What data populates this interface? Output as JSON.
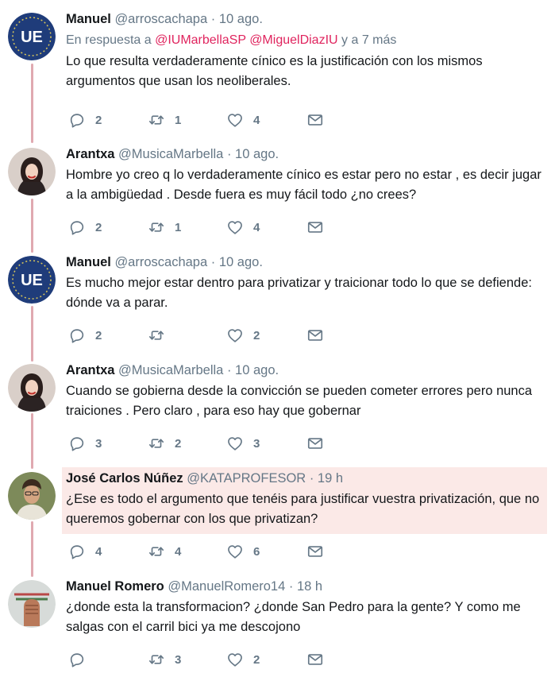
{
  "colors": {
    "thread_line": "#e0a9b0",
    "highlight_bg": "#fbe9e7",
    "mention": "#e0245e",
    "secondary_text": "#657786"
  },
  "tweets": [
    {
      "name": "Manuel",
      "handle": "@arroscachapa",
      "time": "10 ago.",
      "avatar_icon": "ue-logo-avatar",
      "avatar_text": "UE",
      "reply_to": {
        "prefix": "En respuesta a",
        "mentions": [
          "@IUMarbellaSP",
          "@MiguelDiazIU"
        ],
        "suffix": "y a 7 más"
      },
      "text": "Lo que resulta verdaderamente cínico es la justificación con los mismos argumentos que usan los neoliberales.",
      "replies": "2",
      "retweets": "1",
      "likes": "4"
    },
    {
      "name": "Arantxa",
      "handle": "@MusicaMarbella",
      "time": "10 ago.",
      "avatar_icon": "woman-portrait-avatar",
      "text": "Hombre yo creo q lo verdaderamente cínico es estar pero no estar , es decir jugar a la ambigüedad . Desde fuera es muy fácil todo ¿no crees?",
      "replies": "2",
      "retweets": "1",
      "likes": "4"
    },
    {
      "name": "Manuel",
      "handle": "@arroscachapa",
      "time": "10 ago.",
      "avatar_icon": "ue-logo-avatar",
      "avatar_text": "UE",
      "text": "Es mucho mejor estar dentro para privatizar y traicionar todo lo que se defiende: dónde va a parar.",
      "replies": "2",
      "retweets": "",
      "likes": "2"
    },
    {
      "name": "Arantxa",
      "handle": "@MusicaMarbella",
      "time": "10 ago.",
      "avatar_icon": "woman-portrait-avatar",
      "text": "Cuando se gobierna desde la convicción se pueden cometer  errores pero nunca traiciones . Pero claro , para eso hay que gobernar",
      "replies": "3",
      "retweets": "2",
      "likes": "3"
    },
    {
      "name": "José Carlos Núñez",
      "handle": "@KATAPROFESOR",
      "time": "19 h",
      "avatar_icon": "man-portrait-avatar",
      "text": "¿Ese es todo el argumento que tenéis para justificar vuestra privatización, que no queremos gobernar con los que privatizan?",
      "replies": "4",
      "retweets": "4",
      "likes": "6"
    },
    {
      "name": "Manuel Romero",
      "handle": "@ManuelRomero14",
      "time": "18 h",
      "avatar_icon": "raised-fist-avatar",
      "text": "¿donde esta la transformacion? ¿donde San Pedro para la gente? Y como me salgas con el carril bici ya me descojono",
      "replies": "",
      "retweets": "3",
      "likes": "2"
    }
  ]
}
